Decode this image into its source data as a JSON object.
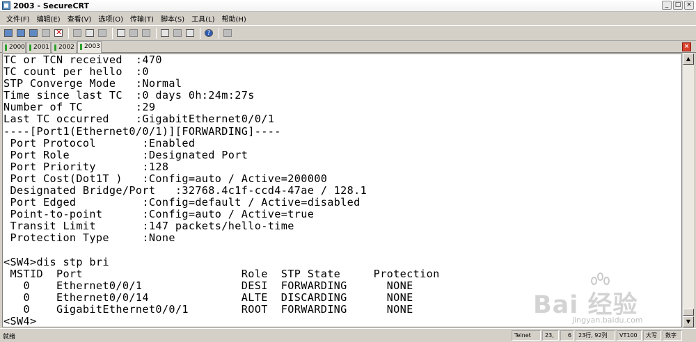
{
  "window": {
    "title": "2003 - SecureCRT",
    "controls": [
      "_",
      "□",
      "×"
    ]
  },
  "menu": [
    "文件(F)",
    "编辑(E)",
    "查看(V)",
    "选项(O)",
    "传输(T)",
    "脚本(S)",
    "工具(L)",
    "帮助(H)"
  ],
  "toolbar_icons": [
    "connect-icon",
    "quick-connect-icon",
    "connect-tab-icon",
    "reconnect-icon",
    "disconnect-icon",
    "copy-icon",
    "paste-icon",
    "find-icon",
    "print-icon",
    "print-selection-icon",
    "print-setup-icon",
    "session-options-icon",
    "global-options-icon",
    "keymap-icon",
    "help-icon",
    "sftp-icon"
  ],
  "tabs": [
    {
      "label": "2000",
      "active": false
    },
    {
      "label": "2001",
      "active": false
    },
    {
      "label": "2002",
      "active": false
    },
    {
      "label": "2003",
      "active": true
    }
  ],
  "terminal": {
    "lines": [
      "TC or TCN received  :470",
      "TC count per hello  :0",
      "STP Converge Mode   :Normal",
      "Time since last TC  :0 days 0h:24m:27s",
      "Number of TC        :29",
      "Last TC occurred    :GigabitEthernet0/0/1",
      "----[Port1(Ethernet0/0/1)][FORWARDING]----",
      " Port Protocol       :Enabled",
      " Port Role           :Designated Port",
      " Port Priority       :128",
      " Port Cost(Dot1T )   :Config=auto / Active=200000",
      " Designated Bridge/Port   :32768.4c1f-ccd4-47ae / 128.1",
      " Port Edged          :Config=default / Active=disabled",
      " Point-to-point      :Config=auto / Active=true",
      " Transit Limit       :147 packets/hello-time",
      " Protection Type     :None",
      "",
      "<SW4>dis stp bri",
      " MSTID  Port                        Role  STP State     Protection",
      "   0    Ethernet0/0/1               DESI  FORWARDING      NONE",
      "   0    Ethernet0/0/14              ALTE  DISCARDING      NONE",
      "   0    GigabitEthernet0/0/1        ROOT  FORWARDING      NONE",
      "<SW4>"
    ]
  },
  "statusbar": {
    "ready": "就绪",
    "protocol": "Telnet",
    "row": "23,",
    "col": "6",
    "position": "23行, 92列",
    "terminal_type": "VT100",
    "caps": "大写",
    "num": "数字"
  },
  "watermark": {
    "logo": "Bai 经验",
    "url": "jingyan.baidu.com"
  },
  "colors": {
    "chrome": "#d4d0c8",
    "terminal_bg": "#ffffff",
    "terminal_fg": "#000000",
    "tab_marker": "#2ea02e",
    "close_tab": "#d9412c"
  }
}
